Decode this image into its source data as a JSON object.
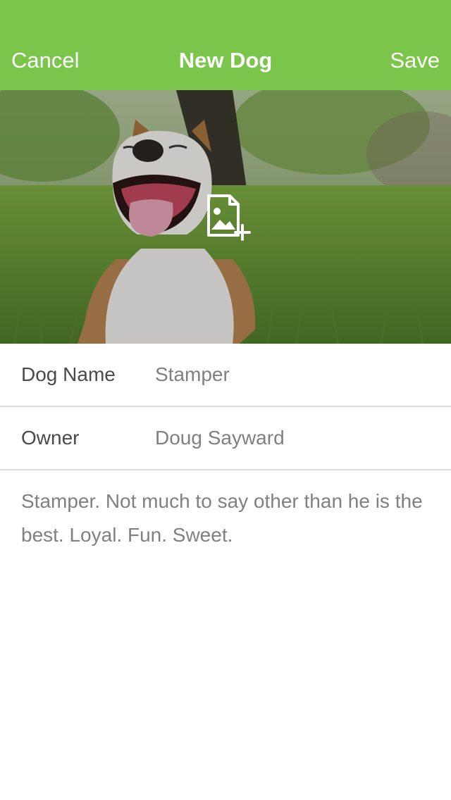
{
  "navbar": {
    "cancel_label": "Cancel",
    "title": "New Dog",
    "save_label": "Save",
    "color": "#7bc54b"
  },
  "photo": {
    "add_icon": "add-image-icon",
    "subject": "dog-photo"
  },
  "form": {
    "dog_name": {
      "label": "Dog Name",
      "value": "Stamper"
    },
    "owner": {
      "label": "Owner",
      "value": "Doug Sayward"
    },
    "notes": "Stamper. Not much to say other than he is the best. Loyal. Fun. Sweet."
  }
}
